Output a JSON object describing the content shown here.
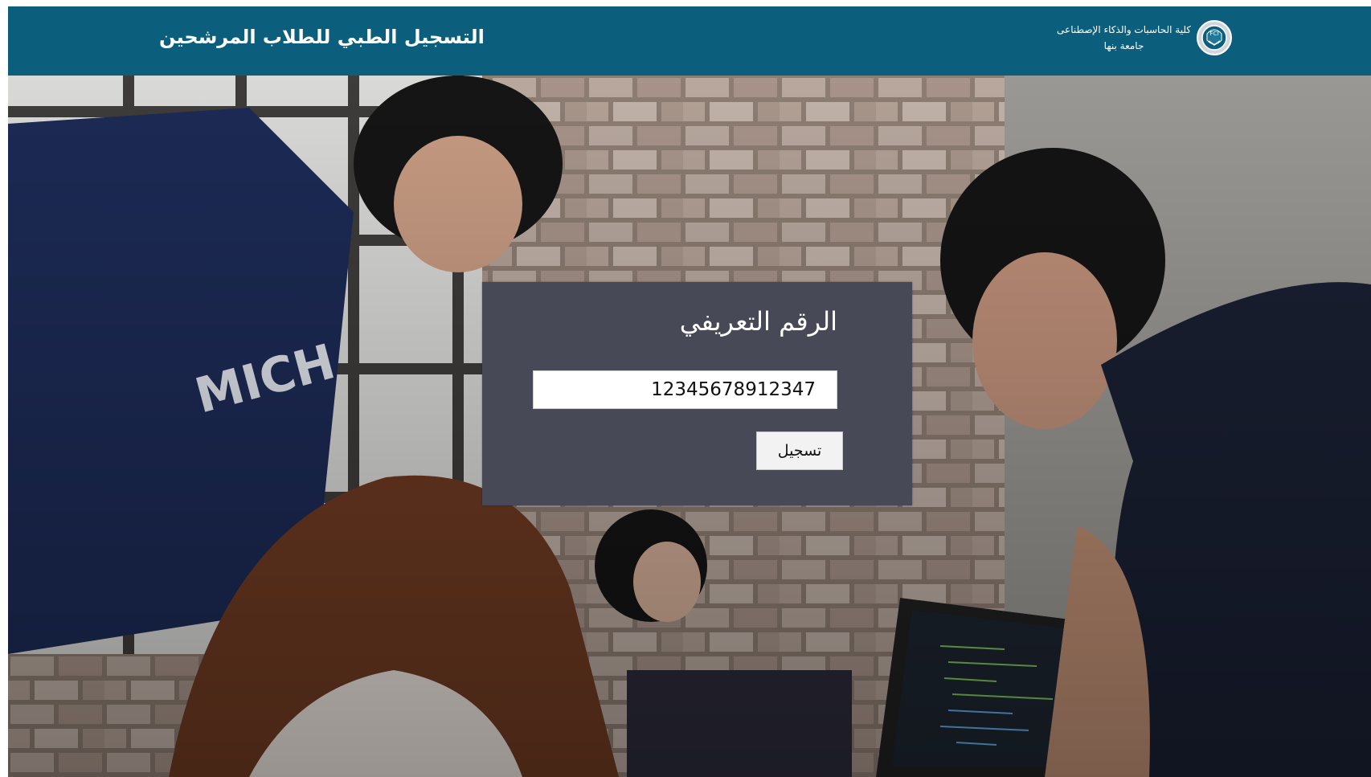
{
  "header": {
    "title": "التسجيل الطبي للطلاب المرشحين",
    "brand": {
      "faculty": "كلية الحاسبات والذكاء الإصطناعى",
      "university": "جامعة بنها",
      "logo_icon": "university-crest-icon"
    },
    "background_color": "#0c5f7c"
  },
  "login": {
    "title": "الرقم التعريفي",
    "id_value": "12345678912347",
    "submit_label": "تسجيل"
  },
  "hero": {
    "description_icon": "students-coding-photo"
  },
  "colors": {
    "card": "#474a56",
    "header": "#0c5f7c"
  }
}
